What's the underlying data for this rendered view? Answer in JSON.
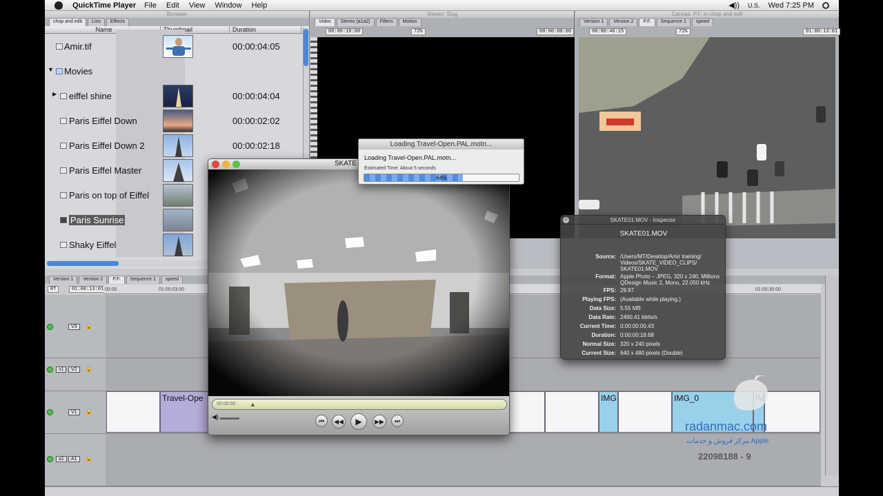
{
  "menubar": {
    "app_name": "QuickTime Player",
    "items": [
      "File",
      "Edit",
      "View",
      "Window",
      "Help"
    ],
    "input_flag": "U.S.",
    "clock": "Wed 7:25 PM"
  },
  "browser": {
    "tabs": [
      "chop and edit",
      "Lins",
      "Effects"
    ],
    "columns": [
      "Name",
      "Thumbnail",
      "Duration"
    ],
    "rows": [
      {
        "name": "Amir.tif",
        "duration": "00:00:04:05",
        "indent": 1
      },
      {
        "name": "Movies",
        "duration": "",
        "indent": 0
      },
      {
        "name": "eiffel shine",
        "duration": "00:00:04:04",
        "indent": 2
      },
      {
        "name": "Paris Eiffel Down",
        "duration": "00:00:02:02",
        "indent": 2
      },
      {
        "name": "Paris Eiffel Down 2",
        "duration": "00:00:02:18",
        "indent": 2
      },
      {
        "name": "Paris Eiffel Master",
        "duration": "",
        "indent": 2
      },
      {
        "name": "Paris on top of Eiffel",
        "duration": "",
        "indent": 2
      },
      {
        "name": "Paris Sunrise",
        "duration": "",
        "indent": 2
      },
      {
        "name": "Shaky Eiffel",
        "duration": "",
        "indent": 2
      }
    ]
  },
  "viewer": {
    "tabs": [
      "Video",
      "Stereo (a1a2)",
      "Filters",
      "Motion"
    ],
    "timecode_left": "00:00:10:00",
    "zoom": "72%",
    "timecode_right": "00:00:00:00"
  },
  "canvas": {
    "tabs": [
      "Version 1",
      "Version 2",
      "P.F.",
      "Sequence 1",
      "speed"
    ],
    "timecode_left": "00:00:46:15",
    "zoom": "72%",
    "timecode_right": "01:00:13:01"
  },
  "timeline": {
    "tabs": [
      "Version 1",
      "Version 2",
      "P.F.",
      "Sequence 1",
      "speed"
    ],
    "rt": "RT",
    "timecode": "01:00:13:01",
    "ruler": [
      "00:00",
      "01:00:03:00",
      "01:00:30:00"
    ],
    "tracks": [
      {
        "src": "",
        "dst": "V3"
      },
      {
        "src": "v1",
        "dst": "V2"
      },
      {
        "src": "",
        "dst": "V1"
      },
      {
        "src": "a1",
        "dst": "A1"
      }
    ],
    "clips": [
      "Travel-Ope",
      "IMG",
      "IMG_0",
      "IM"
    ]
  },
  "qt_player": {
    "title": "SKATE",
    "timecode": "00:00:00",
    "buttons": [
      "go-to-start",
      "rewind",
      "play",
      "fast-forward",
      "go-to-end"
    ]
  },
  "loading": {
    "title": "Loading Travel-Open.PAL.motn...",
    "message": "Loading Travel-Open.PAL.motn...",
    "estimate": "Estimated Time: About 5 seconds",
    "percent_label": "64%",
    "progress": 0.64
  },
  "inspector": {
    "title": "SKATE01.MOV - Inspector",
    "filename": "SKATE01.MOV",
    "rows": [
      {
        "key": "Source:",
        "value": "/Users/MT/Desktop/Amir training/\nVideos/SKATE_VIDEO_CLIPS/\nSKATE01.MOV"
      },
      {
        "key": "Format:",
        "value": "Apple Photo – JPEG, 320 x 240, Millions\nQDesign Music 2, Mono, 22.050 kHz"
      },
      {
        "key": "FPS:",
        "value": "29.97"
      },
      {
        "key": "Playing FPS:",
        "value": "(Available while playing.)"
      },
      {
        "key": "Data Size:",
        "value": "5.55 MB"
      },
      {
        "key": "Data Rate:",
        "value": "2490.41 kbits/s"
      },
      {
        "key": "Current Time:",
        "value": "0:00:00:00.43"
      },
      {
        "key": "Duration:",
        "value": "0:00:00:18.68"
      },
      {
        "key": "Normal Size:",
        "value": "320 x 240 pixels"
      },
      {
        "key": "Current Size:",
        "value": "640 x 480 pixels (Double)"
      }
    ]
  },
  "watermark": {
    "site": "radanmac.com",
    "tagline": "مرکز فروش و خدمات Apple",
    "phone": "22098188 - 9"
  },
  "colors": {
    "selection": "#5a5a5a",
    "progress": "#4f8ee0",
    "clip_purple": "#b6acd9",
    "clip_blue": "#9ad1ea",
    "track_on": "#4bc34b"
  }
}
